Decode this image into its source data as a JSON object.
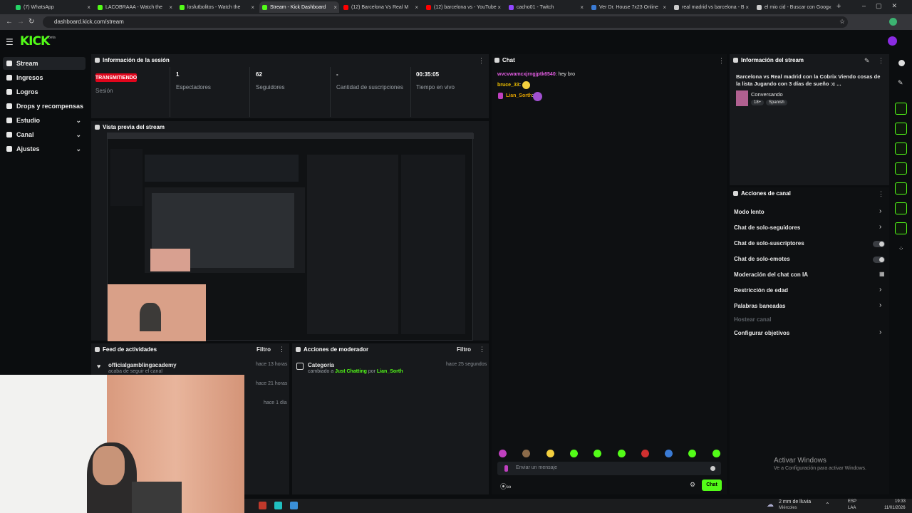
{
  "browser": {
    "tabs": [
      {
        "label": "(7) WhatsApp",
        "color": "#25d366"
      },
      {
        "label": "LACOBRAAA - Watch the",
        "color": "#53fc18"
      },
      {
        "label": "losfutbolitos - Watch the",
        "color": "#53fc18"
      },
      {
        "label": "Stream - Kick Dashboard",
        "color": "#53fc18"
      },
      {
        "label": "(12) Barcelona Vs Real M",
        "color": "#ff0000"
      },
      {
        "label": "(12) barcelona vs - YouTube",
        "color": "#ff0000"
      },
      {
        "label": "cacho01 - Twitch",
        "color": "#9146ff"
      },
      {
        "label": "Ver Dr. House 7x23 Online",
        "color": "#3a7bd5"
      },
      {
        "label": "real madrid vs barcelona - B",
        "color": "#cccccc"
      },
      {
        "label": "el mio cid - Buscar con Goog",
        "color": "#cccccc"
      }
    ],
    "url": "dashboard.kick.com/stream"
  },
  "logo": "KICK",
  "logo_sup": "beta",
  "sidebar": {
    "items": [
      {
        "label": "Stream"
      },
      {
        "label": "Ingresos"
      },
      {
        "label": "Logros"
      },
      {
        "label": "Drops y recompensas"
      },
      {
        "label": "Estudio"
      },
      {
        "label": "Canal"
      },
      {
        "label": "Ajustes"
      }
    ]
  },
  "session": {
    "title": "Información de la sesión",
    "badge": "TRANSMITIENDO",
    "badge_label": "Sesión",
    "viewers_value": "1",
    "viewers_label": "Espectadores",
    "followers_value": "62",
    "followers_label": "Seguidores",
    "subs_value": "-",
    "subs_label": "Cantidad de suscripciones",
    "live_value": "00:35:05",
    "live_label": "Tiempo en vivo"
  },
  "preview": {
    "title": "Vista previa del stream"
  },
  "activity": {
    "title": "Feed de actividades",
    "filter": "Filtro",
    "items": [
      {
        "user": "officialgamblingacademy",
        "text": "acaba de seguir el canal",
        "time": "hace 13 horas"
      },
      {
        "time": "hace 21 horas"
      },
      {
        "time": "hace 1 día"
      }
    ]
  },
  "modactions": {
    "title": "Acciones de moderador",
    "filter": "Filtro",
    "item_title": "Categoría",
    "item_pre": "cambiado a",
    "item_cat": "Just Chatting",
    "item_by": "por",
    "item_user": "Lian_Sorth",
    "item_time": "hace 25 segundos"
  },
  "chat": {
    "title": "Chat",
    "messages": [
      {
        "user": "wvcvwamcxjrngjptk6540",
        "text": ": hey bro",
        "color": "#e05ce0"
      },
      {
        "user": "bruce_33",
        "text": ":",
        "color": "#f0c000"
      },
      {
        "user": "Lian_Sorth",
        "text": ":",
        "color": "#e0a000"
      }
    ],
    "placeholder": "Enviar un mensaje",
    "send": "Chat"
  },
  "stream_info": {
    "title": "Información del stream",
    "description": "Barcelona vs Real madrid con la Cobrix Viendo cosas de la lista Jugando con 3 días de sueño :c ...",
    "category": "Conversando",
    "tag1": "18+",
    "tag2": "Spanish"
  },
  "channel_actions": {
    "title": "Acciones de canal",
    "items": [
      {
        "label": "Modo lento",
        "control": "arrow"
      },
      {
        "label": "Chat de solo-seguidores",
        "control": "arrow"
      },
      {
        "label": "Chat de solo-suscriptores",
        "control": "toggle"
      },
      {
        "label": "Chat de solo-emotes",
        "control": "toggle"
      },
      {
        "label": "Moderación del chat con IA",
        "control": "chart"
      },
      {
        "label": "Restricción de edad",
        "control": "arrow"
      },
      {
        "label": "Palabras baneadas",
        "control": "arrow"
      },
      {
        "label": "Hostear canal",
        "control": "none"
      },
      {
        "label": "Configurar objetivos",
        "control": "arrow"
      }
    ]
  },
  "windows": {
    "activate_title": "Activar Windows",
    "activate_sub": "Ve a Configuración para activar Windows.",
    "weather": "2 mm de lluvia",
    "weather_sub": "Miércoles",
    "lang": "ESP",
    "lang_sub": "LAA",
    "time": "19:33",
    "date": "11/01/2026"
  }
}
